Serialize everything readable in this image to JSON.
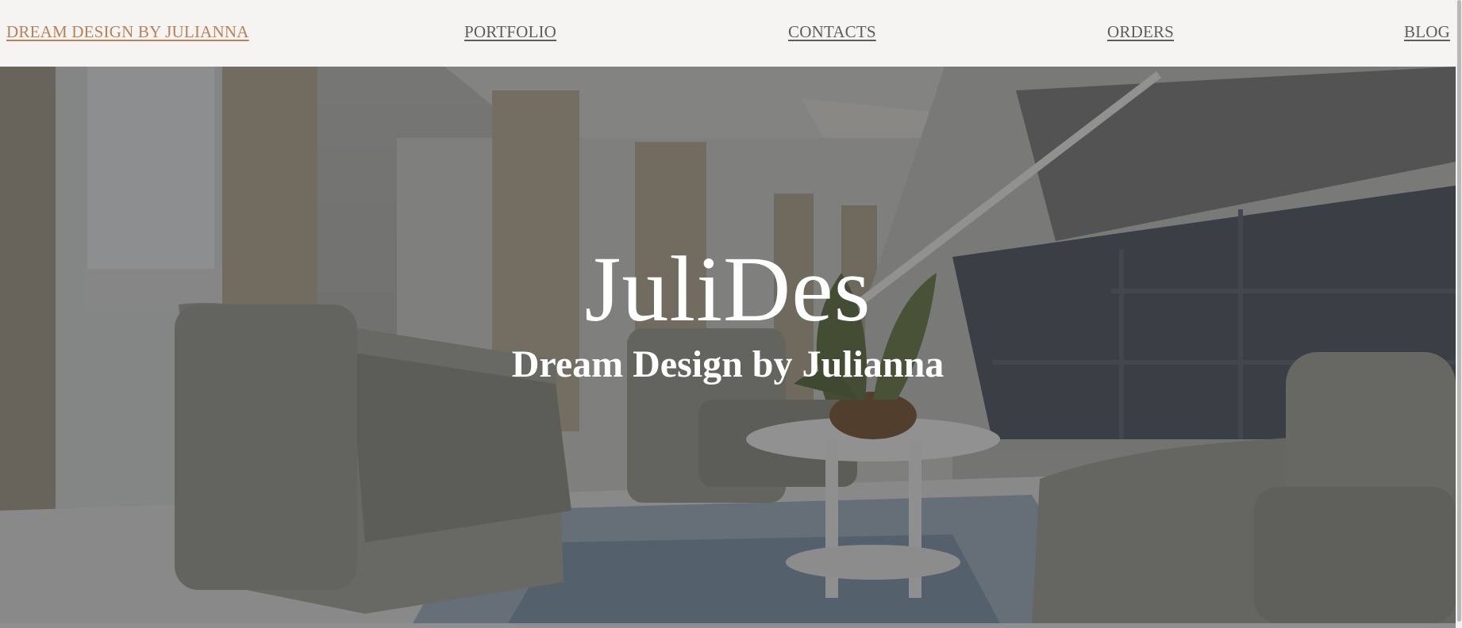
{
  "nav": {
    "brand": "DREAM DESIGN BY JULIANNA",
    "portfolio": "PORTFOLIO",
    "contacts": "CONTACTS",
    "orders": "ORDERS",
    "blog": "BLOG"
  },
  "hero": {
    "title": "JuliDes",
    "subtitle": "Dream Design by Julianna"
  },
  "colors": {
    "nav_background": "#f5f4f2",
    "brand_link": "#b98156",
    "nav_link": "#5d5d5d",
    "hero_text": "#ffffff"
  }
}
